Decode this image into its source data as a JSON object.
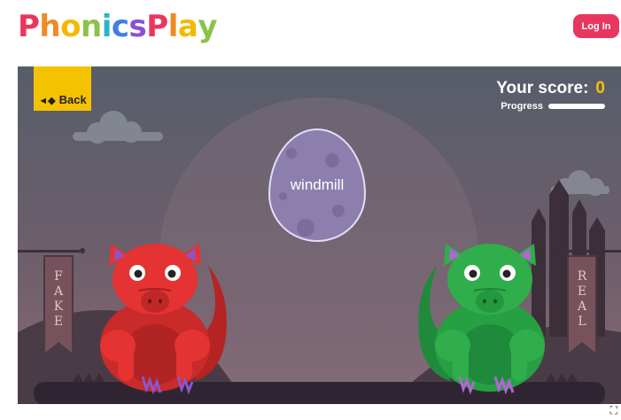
{
  "header": {
    "logo_text": "PhonicsPlay",
    "login_label": "Log In"
  },
  "game": {
    "back_label": "Back",
    "score_label": "Your score:",
    "score_value": "0",
    "progress_label": "Progress",
    "progress_value": 0,
    "word": "windmill",
    "left_banner_letters": [
      "F",
      "A",
      "K",
      "E"
    ],
    "right_banner_letters": [
      "R",
      "E",
      "A",
      "L"
    ],
    "left_dragon_color": "#e53232",
    "right_dragon_color": "#2fae4b"
  },
  "colors": {
    "login": "#e8375f",
    "back": "#f5c200",
    "score_value": "#f5c200",
    "egg": "#8c7fae"
  }
}
